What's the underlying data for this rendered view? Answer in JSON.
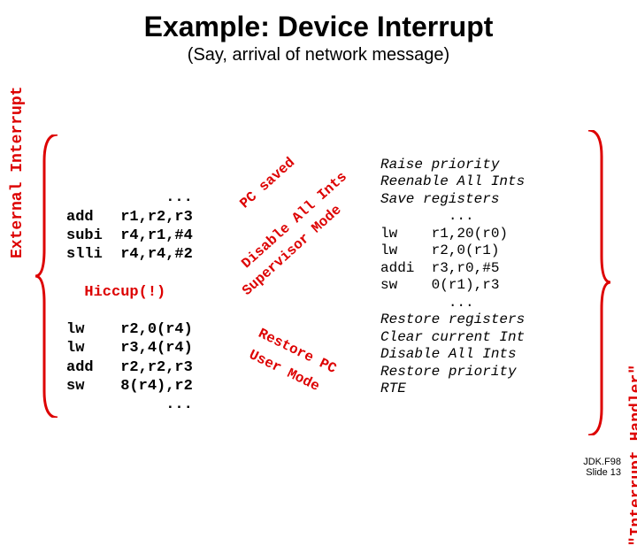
{
  "title": "Example: Device Interrupt",
  "subtitle": "(Say, arrival of network message)",
  "left_label": "External Interrupt",
  "right_label": "\"Interrupt Handler\"",
  "code_block_1": "           ...\nadd   r1,r2,r3\nsubi  r4,r1,#4\nslli  r4,r4,#2",
  "hiccup": "  Hiccup(!)",
  "code_block_2": "lw    r2,0(r4)\nlw    r3,4(r4)\nadd   r2,r2,r3\nsw    8(r4),r2\n           ...",
  "diag1": "PC saved",
  "diag2": "Disable All Ints",
  "diag3": "Supervisor Mode",
  "diag4": "Restore PC",
  "diag5": "User Mode",
  "handler_ital1": "Raise priority\nReenable All Ints\nSave registers",
  "handler_code": "        ...\nlw    r1,20(r0)\nlw    r2,0(r1)\naddi  r3,r0,#5\nsw    0(r1),r3\n        ...",
  "handler_ital2": "Restore registers\nClear current Int\nDisable All Ints\nRestore priority\nRTE",
  "footer1": "JDK.F98",
  "footer2": "Slide 13"
}
